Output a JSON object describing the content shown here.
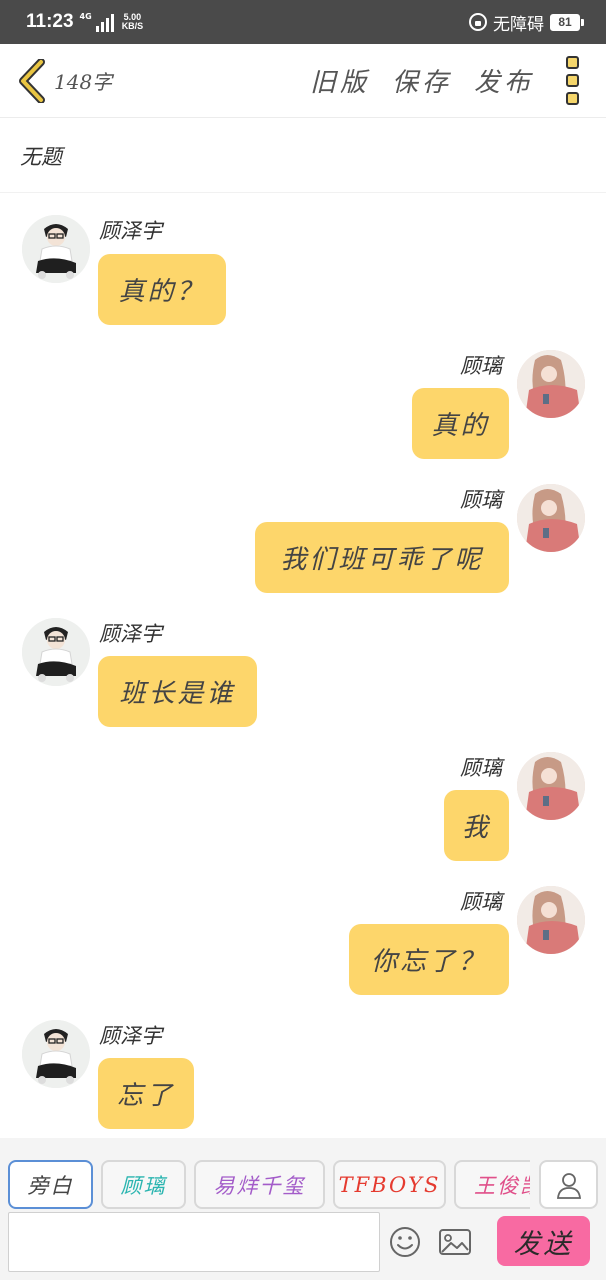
{
  "status_bar": {
    "time": "11:23",
    "network_tag": "4G",
    "speed_value": "5.00",
    "speed_unit": "KB/S",
    "accessibility_label": "无障碍",
    "battery": "81"
  },
  "toolbar": {
    "word_count": "148字",
    "old_version_label": "旧版",
    "save_label": "保存",
    "publish_label": "发布"
  },
  "document": {
    "title": "无题"
  },
  "messages": [
    {
      "speaker": "顾泽宇",
      "text": "真的？",
      "side": "left"
    },
    {
      "speaker": "顾璃",
      "text": "真的",
      "side": "right"
    },
    {
      "speaker": "顾璃",
      "text": "我们班可乖了呢",
      "side": "right"
    },
    {
      "speaker": "顾泽宇",
      "text": "班长是谁",
      "side": "left"
    },
    {
      "speaker": "顾璃",
      "text": "我",
      "side": "right"
    },
    {
      "speaker": "顾璃",
      "text": "你忘了？",
      "side": "right"
    },
    {
      "speaker": "顾泽宇",
      "text": "忘了",
      "side": "left"
    }
  ],
  "roles": [
    {
      "label": "旁白",
      "color": "#444444"
    },
    {
      "label": "顾璃",
      "color": "#2bb5b0"
    },
    {
      "label": "易烊千玺",
      "color": "#a35cc9"
    },
    {
      "label": "TFBOYS",
      "color": "#e53a2f"
    },
    {
      "label": "王俊凯",
      "color": "#e0508a"
    }
  ],
  "composer": {
    "input_value": "",
    "send_label": "发送"
  },
  "colors": {
    "bubble": "#fdd66b",
    "send_button": "#f86aa2",
    "back_chevron": "#e9c542",
    "active_role_border": "#5b8fd6"
  }
}
